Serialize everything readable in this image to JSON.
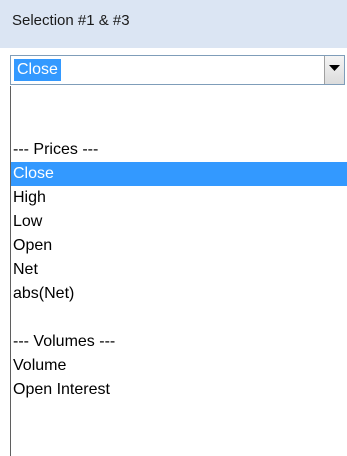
{
  "header": {
    "title": "Selection #1 & #3"
  },
  "combo": {
    "value": "Close",
    "dropdown_icon": "chevron-down-icon"
  },
  "dropdown": {
    "selected_index": 1,
    "items": [
      "",
      "--- Prices ---",
      "Close",
      "High",
      "Low",
      "Open",
      "Net",
      "abs(Net)",
      "",
      "--- Volumes ---",
      "Volume",
      "Open Interest"
    ]
  },
  "colors": {
    "header_bg": "#dbe5f3",
    "selection_bg": "#3399ff",
    "selection_text": "#ffffff"
  }
}
